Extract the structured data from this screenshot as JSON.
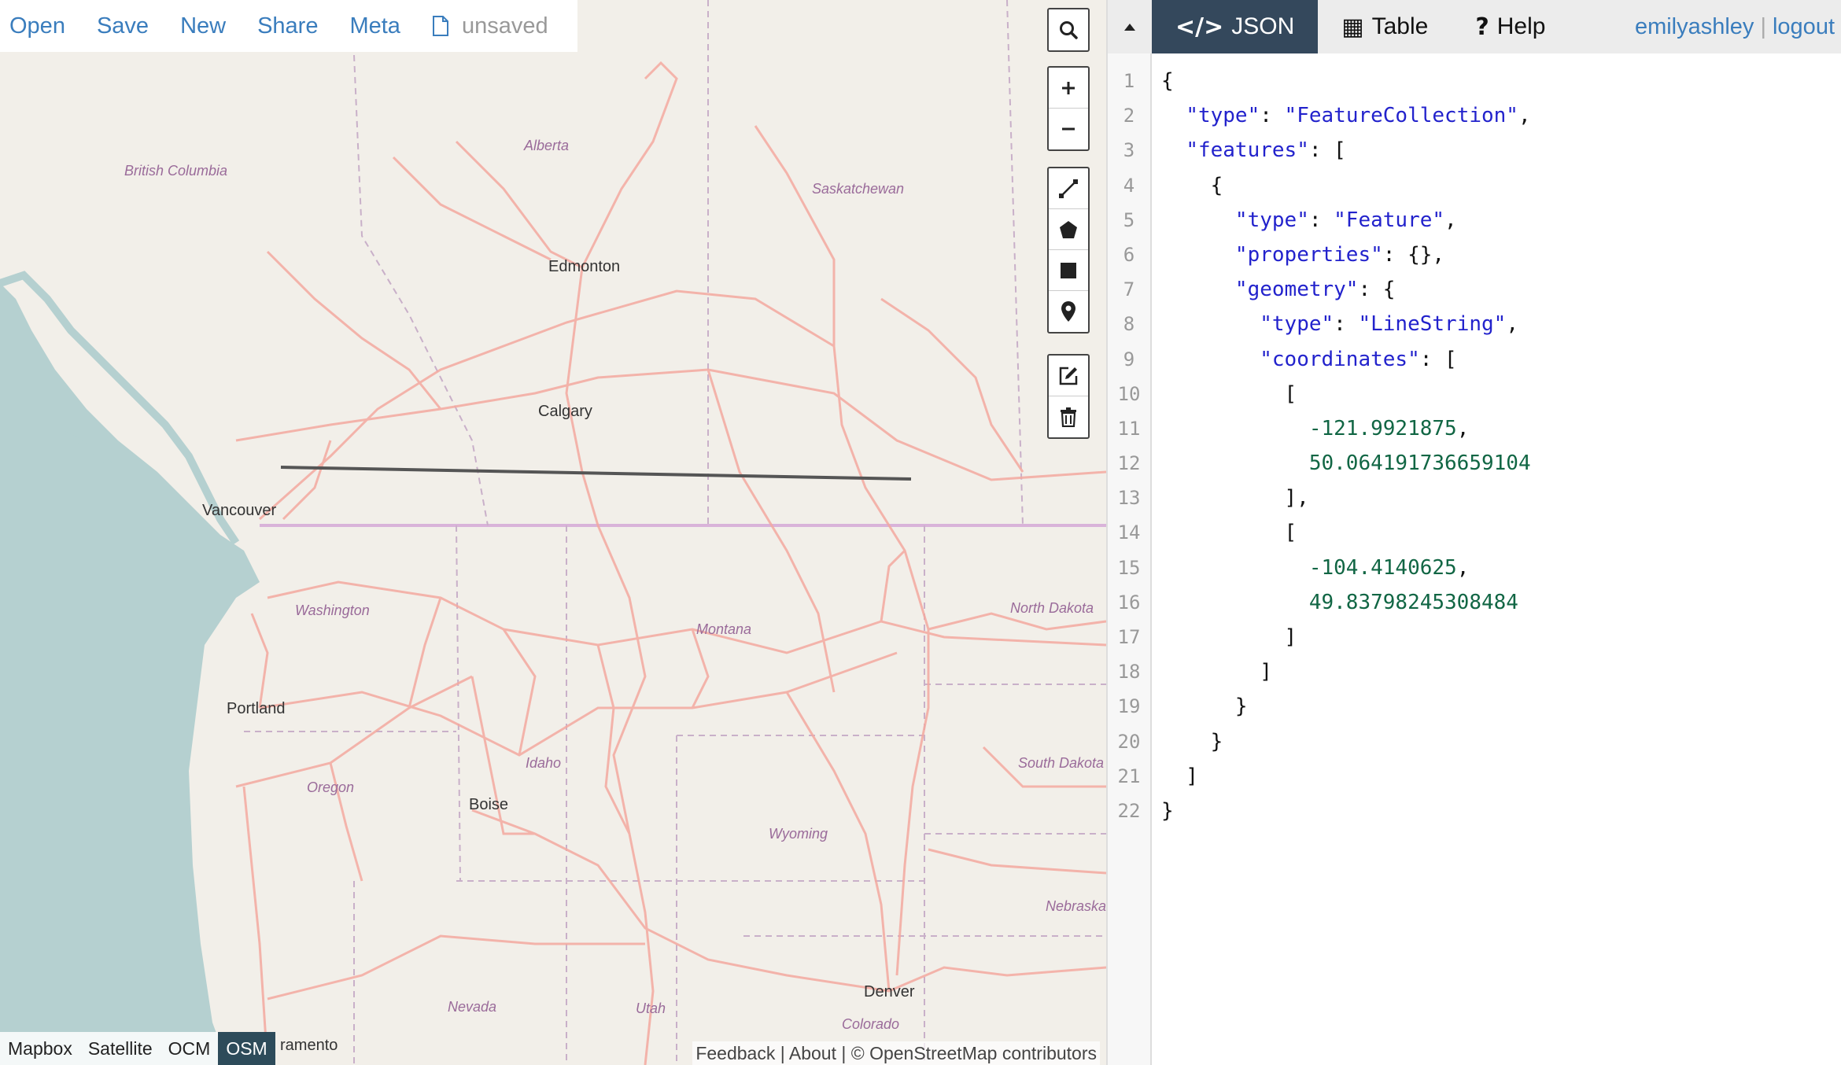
{
  "toolbar": {
    "open": "Open",
    "save": "Save",
    "new": "New",
    "share": "Share",
    "meta": "Meta",
    "status": "unsaved"
  },
  "map": {
    "labels": {
      "british_columbia": "British Columbia",
      "alberta": "Alberta",
      "saskatchewan": "Saskatchewan",
      "edmonton": "Edmonton",
      "calgary": "Calgary",
      "vancouver": "Vancouver",
      "washington": "Washington",
      "montana": "Montana",
      "north_dakota": "North Dakota",
      "portland": "Portland",
      "idaho": "Idaho",
      "south_dakota": "South Dakota",
      "oregon": "Oregon",
      "boise": "Boise",
      "wyoming": "Wyoming",
      "nebraska": "Nebraska",
      "nevada": "Nevada",
      "utah": "Utah",
      "denver": "Denver",
      "colorado": "Colorado",
      "sacramento": "ramento"
    },
    "layers": [
      "Mapbox",
      "Satellite",
      "OCM",
      "OSM"
    ],
    "active_layer": "OSM",
    "attribution": {
      "feedback": "Feedback",
      "about": "About",
      "osm": "© OpenStreetMap contributors"
    },
    "colors": {
      "land": "#f2efe9",
      "water": "#b5d0d0",
      "road": "#f4a9a0",
      "border": "#c9a0c9",
      "drawn_line": "#555555"
    }
  },
  "panel": {
    "tabs": [
      {
        "icon": "</>",
        "label": "JSON"
      },
      {
        "icon": "▦",
        "label": "Table"
      },
      {
        "icon": "?",
        "label": "Help"
      }
    ],
    "active_tab": "JSON",
    "user": "emilyashley",
    "logout": "logout"
  },
  "editor": {
    "line_numbers": [
      "1",
      "2",
      "3",
      "4",
      "5",
      "6",
      "7",
      "8",
      "9",
      "10",
      "11",
      "12",
      "13",
      "14",
      "15",
      "16",
      "17",
      "18",
      "19",
      "20",
      "21",
      "22"
    ],
    "json": {
      "type_key": "\"type\"",
      "type_val": "\"FeatureCollection\"",
      "features_key": "\"features\"",
      "feature_type_key": "\"type\"",
      "feature_type_val": "\"Feature\"",
      "properties_key": "\"properties\"",
      "geometry_key": "\"geometry\"",
      "geom_type_key": "\"type\"",
      "geom_type_val": "\"LineString\"",
      "coordinates_key": "\"coordinates\"",
      "c1_lon": "-121.9921875",
      "c1_lat": "50.064191736659104",
      "c2_lon": "-104.4140625",
      "c2_lat": "49.83798245308484"
    }
  }
}
